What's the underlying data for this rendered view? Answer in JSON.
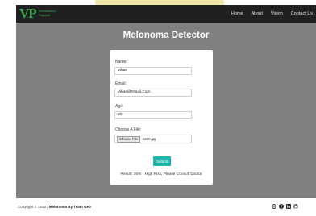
{
  "brand": {
    "mark": "VP",
    "line1": "Vishwakarma",
    "line2": "Prajapati"
  },
  "nav": {
    "items": [
      "Home",
      "About",
      "Vision",
      "Contact Us"
    ]
  },
  "hero": {
    "title": "Melonoma Detector"
  },
  "form": {
    "name_label": "Name:",
    "name_value": "Vikas",
    "email_label": "Email:",
    "email_value": "Vikas@Gmail.Com",
    "age_label": "Age:",
    "age_value": "20",
    "file_label": "Choose A File:",
    "file_button": "Choose File",
    "file_name": "0200.jpg",
    "submit_label": "Submit",
    "result_text": "Result: 36% - High Risk, Please Consult Doctor"
  },
  "footer": {
    "copyright_prefix": "Copyright © 2022 |",
    "copyright_name": "Melonoma By Team Geo",
    "icons": [
      "globe-icon",
      "facebook-icon",
      "linkedin-icon",
      "github-icon"
    ]
  },
  "colors": {
    "navbar": "#1f2022",
    "brand_green": "#3fa34d",
    "hero_bg": "#808080",
    "submit": "#1fb5a9"
  }
}
